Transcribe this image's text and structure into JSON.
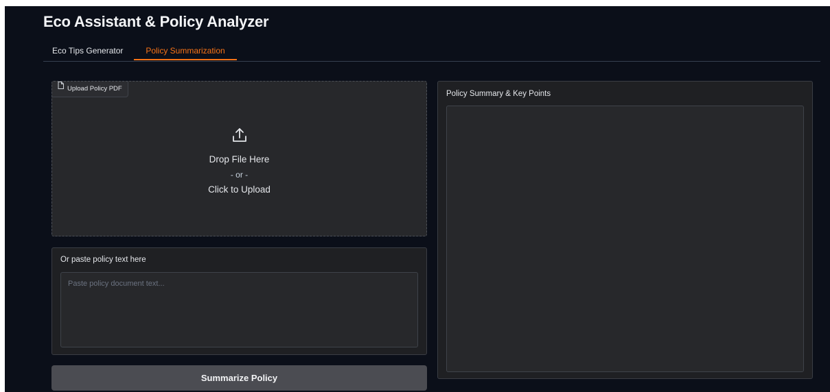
{
  "app": {
    "title": "Eco Assistant & Policy Analyzer"
  },
  "tabs": [
    {
      "label": "Eco Tips Generator",
      "active": false
    },
    {
      "label": "Policy Summarization",
      "active": true
    }
  ],
  "upload": {
    "label": "Upload Policy PDF",
    "drop_text": "Drop File Here",
    "or_text": "- or -",
    "click_text": "Click to Upload",
    "icons": {
      "label_icon": "file-icon",
      "center_icon": "upload-icon"
    }
  },
  "paste": {
    "label": "Or paste policy text here",
    "value": "",
    "placeholder": "Paste policy document text..."
  },
  "button": {
    "label": "Summarize Policy"
  },
  "summary": {
    "label": "Policy Summary & Key Points",
    "value": ""
  },
  "colors": {
    "accent": "#f97316",
    "background": "#0b0f19",
    "panel": "#1f2023",
    "button": "#4b4c52"
  }
}
